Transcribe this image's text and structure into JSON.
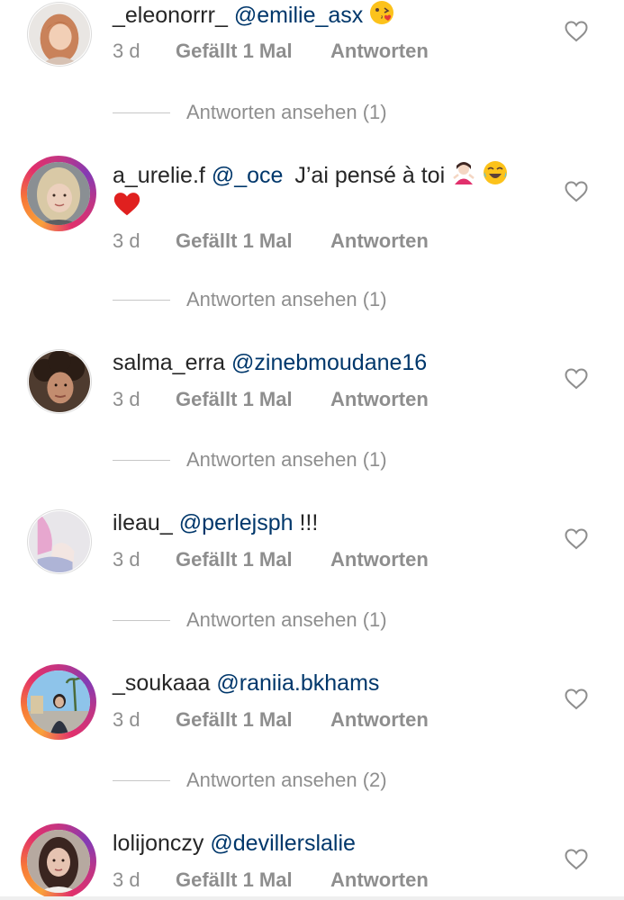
{
  "comments": [
    {
      "username": "_eleonorrr_",
      "mention": "@emilie_asx",
      "text": "",
      "time": "3 d",
      "likes": "Gefällt 1 Mal",
      "reply": "Antworten",
      "view_replies": "Antworten ansehen (1)",
      "avatar_icon": "avatar-girl-redhair",
      "emoji": "kiss-emoji"
    },
    {
      "username": "a_urelie.f",
      "mention": "@_oce",
      "text": "J’ai pensé à toi",
      "time": "3 d",
      "likes": "Gefällt 1 Mal",
      "reply": "Antworten",
      "view_replies": "Antworten ansehen (1)",
      "avatar_icon": "avatar-girl-blonde",
      "emoji": "woman-shrug-emoji laughing-emoji red-heart-emoji"
    },
    {
      "username": "salma_erra",
      "mention": "@zinebmoudane16",
      "text": "",
      "time": "3 d",
      "likes": "Gefällt 1 Mal",
      "reply": "Antworten",
      "view_replies": "Antworten ansehen (1)",
      "avatar_icon": "avatar-curly-hair"
    },
    {
      "username": "ileau_",
      "mention": "@perlejsph",
      "text": "!!!",
      "time": "3 d",
      "likes": "Gefällt 1 Mal",
      "reply": "Antworten",
      "view_replies": "Antworten ansehen (1)",
      "avatar_icon": "avatar-pink-top"
    },
    {
      "username": "_soukaaa",
      "mention": "@raniia.bkhams",
      "text": "",
      "time": "3 d",
      "likes": "Gefällt 1 Mal",
      "reply": "Antworten",
      "view_replies": "Antworten ansehen (2)",
      "avatar_icon": "avatar-street-photo"
    },
    {
      "username": "lolijonczy",
      "mention": "@devillerslalie",
      "text": "",
      "time": "3 d",
      "likes": "Gefällt 1 Mal",
      "reply": "Antworten",
      "avatar_icon": "avatar-dark-hair"
    }
  ],
  "colors": {
    "username": "#262626",
    "mention": "#00376b",
    "meta": "#8e8e8e",
    "story_ring": "#e1306c"
  }
}
